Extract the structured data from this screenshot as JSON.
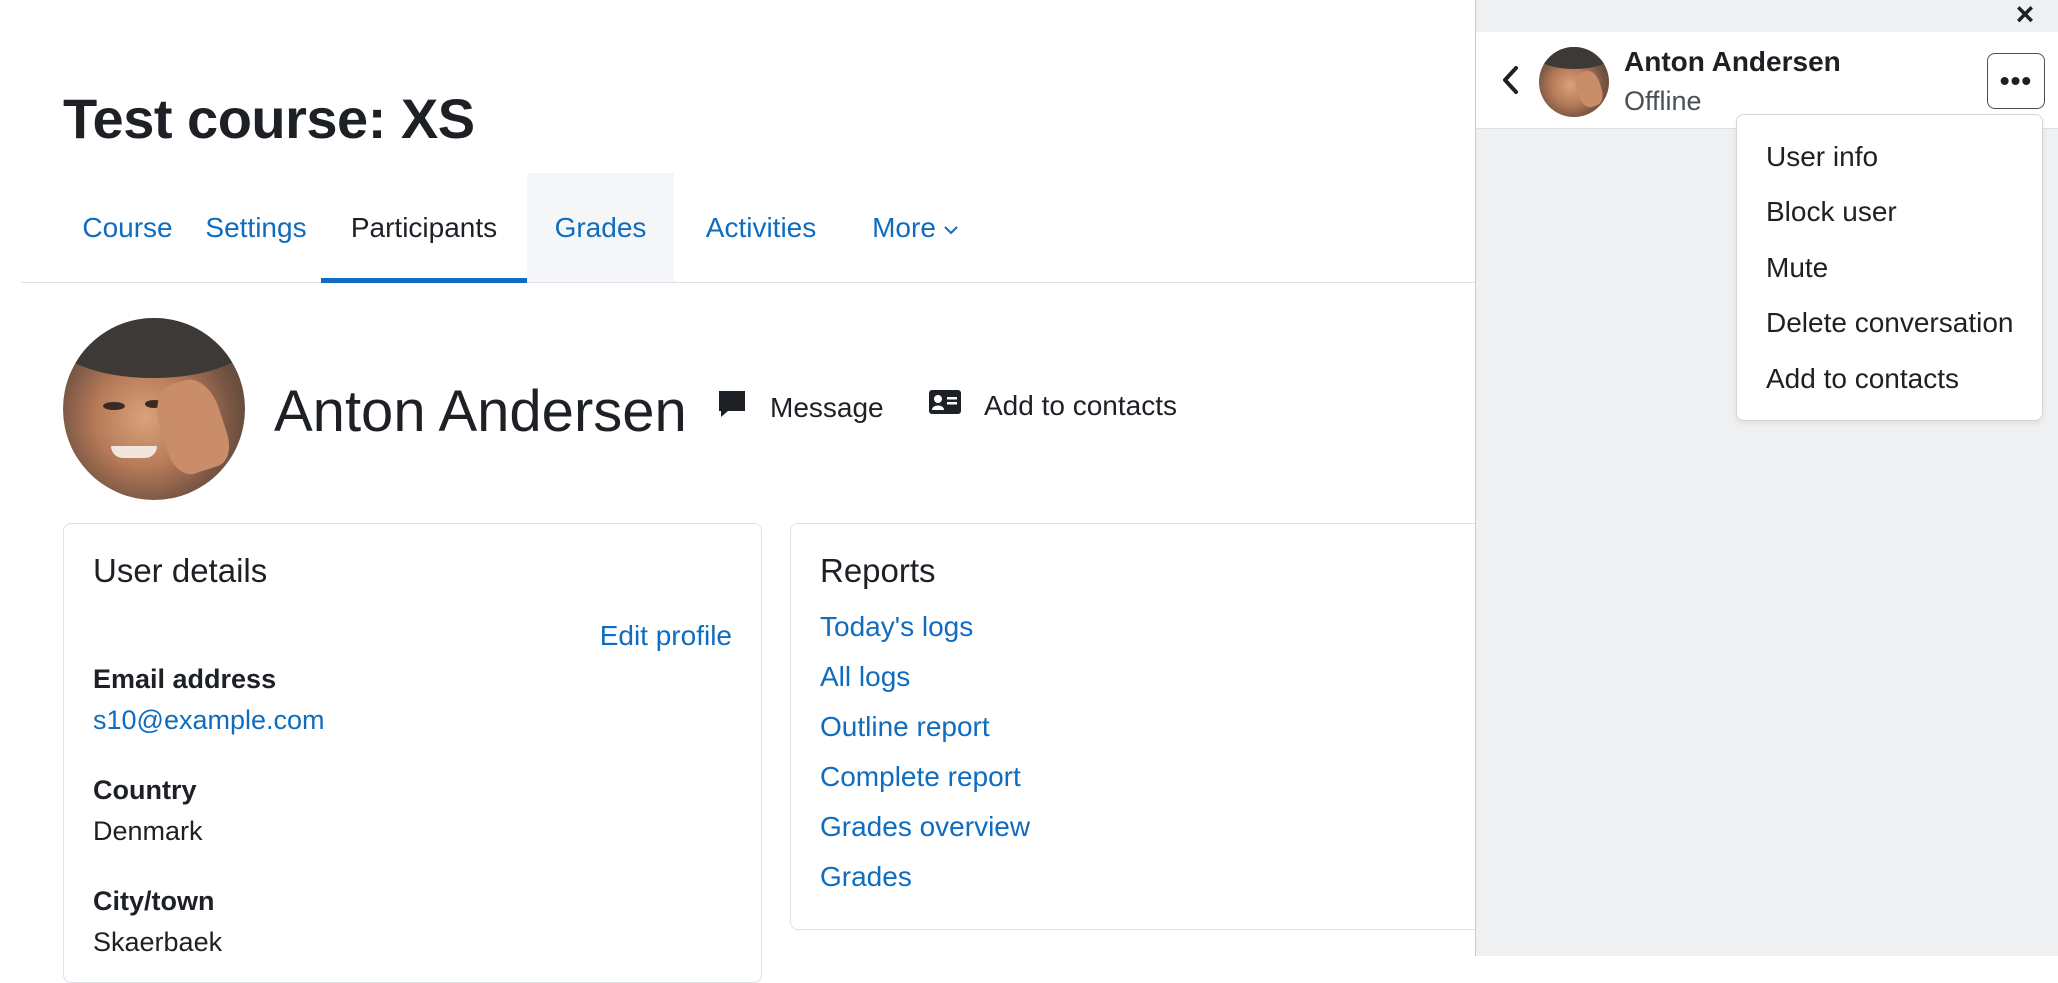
{
  "course": {
    "title": "Test course: XS"
  },
  "tabs": [
    {
      "label": "Course"
    },
    {
      "label": "Settings"
    },
    {
      "label": "Participants"
    },
    {
      "label": "Grades"
    },
    {
      "label": "Activities"
    },
    {
      "label": "More",
      "icon": "chevron-down-icon"
    }
  ],
  "profile": {
    "name": "Anton Andersen",
    "message_label": "Message",
    "add_contacts_label": "Add to contacts"
  },
  "user_details": {
    "heading": "User details",
    "edit_profile": "Edit profile",
    "email_label": "Email address",
    "email_value": "s10@example.com",
    "country_label": "Country",
    "country_value": "Denmark",
    "city_label": "City/town",
    "city_value": "Skaerbaek"
  },
  "reports": {
    "heading": "Reports",
    "links": [
      "Today's logs",
      "All logs",
      "Outline report",
      "Complete report",
      "Grades overview",
      "Grades"
    ]
  },
  "drawer": {
    "contact_name": "Anton Andersen",
    "status": "Offline",
    "close_icon": "×",
    "more_icon": "•••",
    "menu": [
      "User info",
      "Block user",
      "Mute",
      "Delete conversation",
      "Add to contacts"
    ]
  },
  "colors": {
    "link": "#0f6cbf",
    "text": "#1d2125",
    "drawer_bg": "#eef0f2"
  }
}
